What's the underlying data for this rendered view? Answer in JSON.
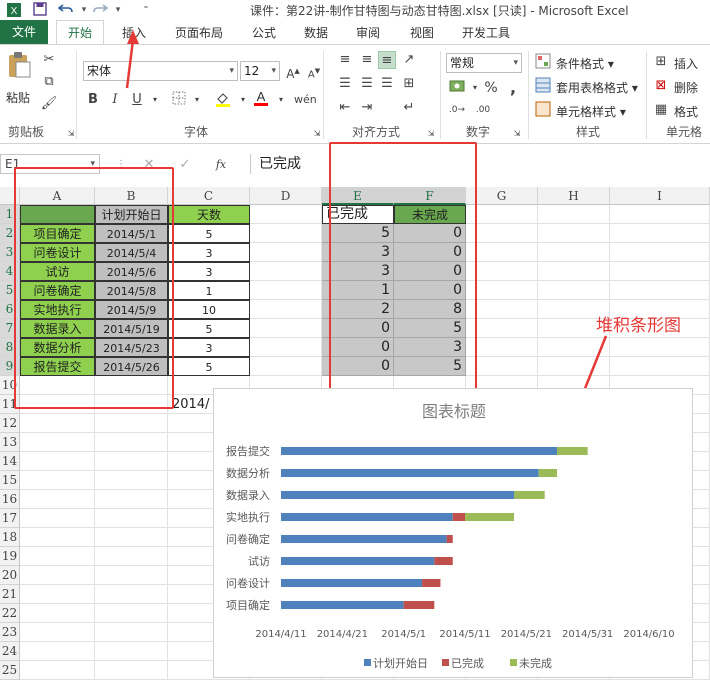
{
  "window": {
    "title": "课件：第22讲-制作甘特图与动态甘特图.xlsx  [只读] - Microsoft Excel"
  },
  "quick_access": {
    "icons": [
      "save-icon",
      "undo-icon",
      "redo-icon",
      "customize-icon"
    ]
  },
  "tabs": [
    {
      "label": "文件",
      "active": false
    },
    {
      "label": "开始",
      "active": true
    },
    {
      "label": "插入",
      "active": false
    },
    {
      "label": "页面布局",
      "active": false
    },
    {
      "label": "公式",
      "active": false
    },
    {
      "label": "数据",
      "active": false
    },
    {
      "label": "审阅",
      "active": false
    },
    {
      "label": "视图",
      "active": false
    },
    {
      "label": "开发工具",
      "active": false
    }
  ],
  "ribbon": {
    "clipboard": {
      "paste_label": "粘贴",
      "group_label": "剪贴板"
    },
    "font": {
      "font_name": "宋体",
      "font_size": "12",
      "group_label": "字体",
      "bold": "B",
      "italic": "I",
      "underline": "U"
    },
    "alignment": {
      "group_label": "对齐方式"
    },
    "number": {
      "format": "常规",
      "percent": "%",
      "comma": ",",
      "group_label": "数字"
    },
    "styles": {
      "conditional": "条件格式",
      "table_format": "套用表格格式",
      "cell_style": "单元格样式",
      "group_label": "样式"
    },
    "cells": {
      "insert": "插入",
      "delete": "删除",
      "format": "格式",
      "group_label": "单元格"
    }
  },
  "formula_bar": {
    "name_box": "E1",
    "fx_label": "fx",
    "formula": "已完成"
  },
  "columns": [
    "A",
    "B",
    "C",
    "D",
    "E",
    "F",
    "G",
    "H",
    "I"
  ],
  "rows": [
    "1",
    "2",
    "3",
    "4",
    "5",
    "6",
    "7",
    "8",
    "9",
    "10",
    "11",
    "12",
    "13",
    "14",
    "15",
    "16",
    "17",
    "18",
    "19",
    "20",
    "21",
    "22",
    "23",
    "24",
    "25"
  ],
  "table_left": {
    "header_b": "计划开始日",
    "header_c": "天数",
    "rows": [
      {
        "task": "项目确定",
        "start": "2014/5/1",
        "days": "5"
      },
      {
        "task": "问卷设计",
        "start": "2014/5/4",
        "days": "3"
      },
      {
        "task": "试访",
        "start": "2014/5/6",
        "days": "3"
      },
      {
        "task": "问卷确定",
        "start": "2014/5/8",
        "days": "1"
      },
      {
        "task": "实地执行",
        "start": "2014/5/9",
        "days": "10"
      },
      {
        "task": "数据录入",
        "start": "2014/5/19",
        "days": "5"
      },
      {
        "task": "数据分析",
        "start": "2014/5/23",
        "days": "3"
      },
      {
        "task": "报告提交",
        "start": "2014/5/26",
        "days": "5"
      }
    ]
  },
  "table_right": {
    "header_e": "已完成",
    "header_f": "未完成",
    "rows": [
      {
        "done": "5",
        "todo": "0"
      },
      {
        "done": "3",
        "todo": "0"
      },
      {
        "done": "3",
        "todo": "0"
      },
      {
        "done": "1",
        "todo": "0"
      },
      {
        "done": "2",
        "todo": "8"
      },
      {
        "done": "0",
        "todo": "5"
      },
      {
        "done": "0",
        "todo": "3"
      },
      {
        "done": "0",
        "todo": "5"
      }
    ]
  },
  "overflow_text": "2014/",
  "annotation": "堆积条形图",
  "colors": {
    "excel_green": "#217346",
    "annotation_red": "#e53935",
    "series_start": "#4f81bd",
    "series_done": "#c0504d",
    "series_todo": "#9bbb59"
  },
  "chart_data": {
    "type": "bar",
    "orientation": "horizontal",
    "stacked": true,
    "title": "图表标题",
    "categories": [
      "项目确定",
      "问卷设计",
      "试访",
      "问卷确定",
      "实地执行",
      "数据录入",
      "数据分析",
      "报告提交"
    ],
    "series": [
      {
        "name": "计划开始日",
        "values": [
          "2014/5/1",
          "2014/5/4",
          "2014/5/6",
          "2014/5/8",
          "2014/5/9",
          "2014/5/19",
          "2014/5/23",
          "2014/5/26"
        ],
        "hidden_in_style": false
      },
      {
        "name": "已完成",
        "values": [
          5,
          3,
          3,
          1,
          2,
          0,
          0,
          0
        ]
      },
      {
        "name": "未完成",
        "values": [
          0,
          0,
          0,
          0,
          8,
          5,
          3,
          5
        ]
      }
    ],
    "x_ticks": [
      "2014/4/11",
      "2014/4/21",
      "2014/5/1",
      "2014/5/11",
      "2014/5/21",
      "2014/5/31",
      "2014/6/10"
    ],
    "xlim": [
      "2014/4/11",
      "2014/6/10"
    ],
    "legend_position": "bottom",
    "legend": [
      "计划开始日",
      "已完成",
      "未完成"
    ],
    "grid": false
  }
}
